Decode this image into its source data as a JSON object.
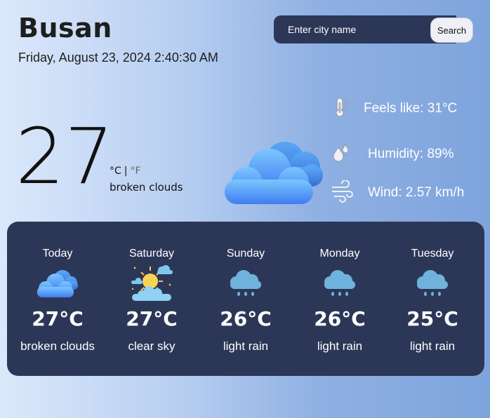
{
  "header": {
    "city": "Busan",
    "datetime": "Friday, August 23, 2024 2:40:30 AM"
  },
  "search": {
    "placeholder": "Enter city name",
    "button_label": "Search"
  },
  "current": {
    "temp": "27",
    "unit_c": "°C",
    "unit_sep": "|",
    "unit_f": "°F",
    "description": "broken clouds",
    "icon": "cloud-icon"
  },
  "details": {
    "feels_like": "Feels like: 31°C",
    "humidity": "Humidity: 89%",
    "wind": "Wind: 2.57 km/h"
  },
  "forecast": [
    {
      "day": "Today",
      "temp": "27°C",
      "desc": "broken clouds",
      "icon": "cloud-icon"
    },
    {
      "day": "Saturday",
      "temp": "27°C",
      "desc": "clear sky",
      "icon": "sun-cloud-icon"
    },
    {
      "day": "Sunday",
      "temp": "26°C",
      "desc": "light rain",
      "icon": "rain-cloud-icon"
    },
    {
      "day": "Monday",
      "temp": "26°C",
      "desc": "light rain",
      "icon": "rain-cloud-icon"
    },
    {
      "day": "Tuesday",
      "temp": "25°C",
      "desc": "light rain",
      "icon": "rain-cloud-icon"
    }
  ],
  "colors": {
    "panel": "#2c3757",
    "cloud_blue": "#4a8df0",
    "rain_cloud": "#6fb2dc"
  }
}
